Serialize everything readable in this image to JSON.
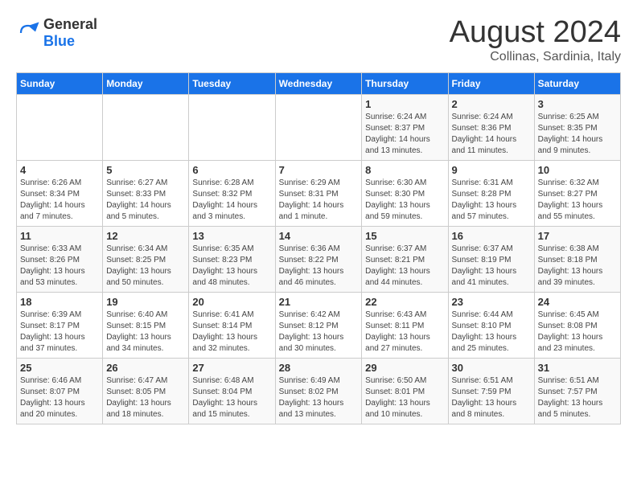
{
  "header": {
    "logo_general": "General",
    "logo_blue": "Blue",
    "main_title": "August 2024",
    "subtitle": "Collinas, Sardinia, Italy"
  },
  "days_of_week": [
    "Sunday",
    "Monday",
    "Tuesday",
    "Wednesday",
    "Thursday",
    "Friday",
    "Saturday"
  ],
  "weeks": [
    [
      {
        "day": "",
        "sunrise": "",
        "sunset": "",
        "daylight": ""
      },
      {
        "day": "",
        "sunrise": "",
        "sunset": "",
        "daylight": ""
      },
      {
        "day": "",
        "sunrise": "",
        "sunset": "",
        "daylight": ""
      },
      {
        "day": "",
        "sunrise": "",
        "sunset": "",
        "daylight": ""
      },
      {
        "day": "1",
        "sunrise": "Sunrise: 6:24 AM",
        "sunset": "Sunset: 8:37 PM",
        "daylight": "Daylight: 14 hours and 13 minutes."
      },
      {
        "day": "2",
        "sunrise": "Sunrise: 6:24 AM",
        "sunset": "Sunset: 8:36 PM",
        "daylight": "Daylight: 14 hours and 11 minutes."
      },
      {
        "day": "3",
        "sunrise": "Sunrise: 6:25 AM",
        "sunset": "Sunset: 8:35 PM",
        "daylight": "Daylight: 14 hours and 9 minutes."
      }
    ],
    [
      {
        "day": "4",
        "sunrise": "Sunrise: 6:26 AM",
        "sunset": "Sunset: 8:34 PM",
        "daylight": "Daylight: 14 hours and 7 minutes."
      },
      {
        "day": "5",
        "sunrise": "Sunrise: 6:27 AM",
        "sunset": "Sunset: 8:33 PM",
        "daylight": "Daylight: 14 hours and 5 minutes."
      },
      {
        "day": "6",
        "sunrise": "Sunrise: 6:28 AM",
        "sunset": "Sunset: 8:32 PM",
        "daylight": "Daylight: 14 hours and 3 minutes."
      },
      {
        "day": "7",
        "sunrise": "Sunrise: 6:29 AM",
        "sunset": "Sunset: 8:31 PM",
        "daylight": "Daylight: 14 hours and 1 minute."
      },
      {
        "day": "8",
        "sunrise": "Sunrise: 6:30 AM",
        "sunset": "Sunset: 8:30 PM",
        "daylight": "Daylight: 13 hours and 59 minutes."
      },
      {
        "day": "9",
        "sunrise": "Sunrise: 6:31 AM",
        "sunset": "Sunset: 8:28 PM",
        "daylight": "Daylight: 13 hours and 57 minutes."
      },
      {
        "day": "10",
        "sunrise": "Sunrise: 6:32 AM",
        "sunset": "Sunset: 8:27 PM",
        "daylight": "Daylight: 13 hours and 55 minutes."
      }
    ],
    [
      {
        "day": "11",
        "sunrise": "Sunrise: 6:33 AM",
        "sunset": "Sunset: 8:26 PM",
        "daylight": "Daylight: 13 hours and 53 minutes."
      },
      {
        "day": "12",
        "sunrise": "Sunrise: 6:34 AM",
        "sunset": "Sunset: 8:25 PM",
        "daylight": "Daylight: 13 hours and 50 minutes."
      },
      {
        "day": "13",
        "sunrise": "Sunrise: 6:35 AM",
        "sunset": "Sunset: 8:23 PM",
        "daylight": "Daylight: 13 hours and 48 minutes."
      },
      {
        "day": "14",
        "sunrise": "Sunrise: 6:36 AM",
        "sunset": "Sunset: 8:22 PM",
        "daylight": "Daylight: 13 hours and 46 minutes."
      },
      {
        "day": "15",
        "sunrise": "Sunrise: 6:37 AM",
        "sunset": "Sunset: 8:21 PM",
        "daylight": "Daylight: 13 hours and 44 minutes."
      },
      {
        "day": "16",
        "sunrise": "Sunrise: 6:37 AM",
        "sunset": "Sunset: 8:19 PM",
        "daylight": "Daylight: 13 hours and 41 minutes."
      },
      {
        "day": "17",
        "sunrise": "Sunrise: 6:38 AM",
        "sunset": "Sunset: 8:18 PM",
        "daylight": "Daylight: 13 hours and 39 minutes."
      }
    ],
    [
      {
        "day": "18",
        "sunrise": "Sunrise: 6:39 AM",
        "sunset": "Sunset: 8:17 PM",
        "daylight": "Daylight: 13 hours and 37 minutes."
      },
      {
        "day": "19",
        "sunrise": "Sunrise: 6:40 AM",
        "sunset": "Sunset: 8:15 PM",
        "daylight": "Daylight: 13 hours and 34 minutes."
      },
      {
        "day": "20",
        "sunrise": "Sunrise: 6:41 AM",
        "sunset": "Sunset: 8:14 PM",
        "daylight": "Daylight: 13 hours and 32 minutes."
      },
      {
        "day": "21",
        "sunrise": "Sunrise: 6:42 AM",
        "sunset": "Sunset: 8:12 PM",
        "daylight": "Daylight: 13 hours and 30 minutes."
      },
      {
        "day": "22",
        "sunrise": "Sunrise: 6:43 AM",
        "sunset": "Sunset: 8:11 PM",
        "daylight": "Daylight: 13 hours and 27 minutes."
      },
      {
        "day": "23",
        "sunrise": "Sunrise: 6:44 AM",
        "sunset": "Sunset: 8:10 PM",
        "daylight": "Daylight: 13 hours and 25 minutes."
      },
      {
        "day": "24",
        "sunrise": "Sunrise: 6:45 AM",
        "sunset": "Sunset: 8:08 PM",
        "daylight": "Daylight: 13 hours and 23 minutes."
      }
    ],
    [
      {
        "day": "25",
        "sunrise": "Sunrise: 6:46 AM",
        "sunset": "Sunset: 8:07 PM",
        "daylight": "Daylight: 13 hours and 20 minutes."
      },
      {
        "day": "26",
        "sunrise": "Sunrise: 6:47 AM",
        "sunset": "Sunset: 8:05 PM",
        "daylight": "Daylight: 13 hours and 18 minutes."
      },
      {
        "day": "27",
        "sunrise": "Sunrise: 6:48 AM",
        "sunset": "Sunset: 8:04 PM",
        "daylight": "Daylight: 13 hours and 15 minutes."
      },
      {
        "day": "28",
        "sunrise": "Sunrise: 6:49 AM",
        "sunset": "Sunset: 8:02 PM",
        "daylight": "Daylight: 13 hours and 13 minutes."
      },
      {
        "day": "29",
        "sunrise": "Sunrise: 6:50 AM",
        "sunset": "Sunset: 8:01 PM",
        "daylight": "Daylight: 13 hours and 10 minutes."
      },
      {
        "day": "30",
        "sunrise": "Sunrise: 6:51 AM",
        "sunset": "Sunset: 7:59 PM",
        "daylight": "Daylight: 13 hours and 8 minutes."
      },
      {
        "day": "31",
        "sunrise": "Sunrise: 6:51 AM",
        "sunset": "Sunset: 7:57 PM",
        "daylight": "Daylight: 13 hours and 5 minutes."
      }
    ]
  ]
}
